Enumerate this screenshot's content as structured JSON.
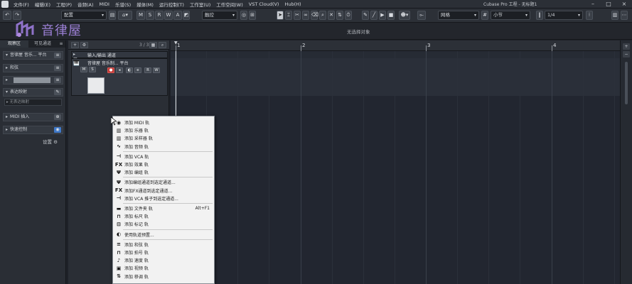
{
  "menubar": {
    "items": [
      "文件(F)",
      "编辑(E)",
      "工程(P)",
      "音频(A)",
      "MIDI",
      "乐谱(S)",
      "媒体(M)",
      "运行控制(T)",
      "工作室(U)",
      "工作空间(W)",
      "VST Cloud(V)",
      "Hub(H)"
    ],
    "window_title": "Cubase Pro 工程 - 无标题1",
    "window_controls": [
      "–",
      "□",
      "×"
    ]
  },
  "toolbar": {
    "undo": "↶",
    "redo": "↷",
    "preset": "配置",
    "mode_buttons": [
      "M",
      "S",
      "R",
      "W",
      "A"
    ],
    "touch_mode": "触控",
    "grid_type": "网格",
    "snap_unit": "小节",
    "quantize": "1/4"
  },
  "logo": {
    "text": "音律屋"
  },
  "info_line": {
    "no_selection": "无选择对象"
  },
  "inspector": {
    "tabs": [
      "观察区",
      "可见通道"
    ],
    "sections": [
      {
        "label": "音律屋 音乐... 平台",
        "icon": "list-icon"
      },
      {
        "label": "和弦",
        "icon": "list-icon"
      },
      {
        "label": "",
        "icon": "list-icon"
      },
      {
        "label": "表达映射",
        "icon": "edit-icon"
      },
      {
        "label": "MIDI 插入",
        "icon": "plug-icon"
      },
      {
        "label": "快速控制",
        "icon": "blue-toggle-icon"
      }
    ],
    "expression_placeholder": "无表达映射",
    "settings_label": "设置"
  },
  "track_list": {
    "count": "3 / 3",
    "tracks": [
      {
        "name": "输入/输出 通道"
      },
      {
        "name": "音律屋 音乐制... 平台",
        "buttons": [
          "M",
          "S",
          "R",
          "W"
        ]
      }
    ]
  },
  "ruler": {
    "bars": [
      "1",
      "2",
      "3",
      "4"
    ]
  },
  "context_menu": {
    "groups": [
      [
        {
          "icon": "midi-icon",
          "label": "添加 MIDI 轨"
        },
        {
          "icon": "piano-icon",
          "label": "添加 乐器 轨"
        },
        {
          "icon": "sampler-icon",
          "label": "添加 采样器 轨"
        },
        {
          "icon": "audio-wave-icon",
          "label": "添加 音频 轨"
        }
      ],
      [
        {
          "icon": "vca-icon",
          "label": "添加 VCA 轨"
        },
        {
          "icon": "fx-icon",
          "label": "添加 效果 轨"
        },
        {
          "icon": "group-icon",
          "label": "添加 编组 轨"
        }
      ],
      [
        {
          "icon": "group-icon",
          "label": "添加编组通道到选定通道..."
        },
        {
          "icon": "fx-icon",
          "label": "添加FX通道到选定通道..."
        },
        {
          "icon": "vca-icon",
          "label": "添加 VCA 推子到选定通道..."
        }
      ],
      [
        {
          "icon": "folder-icon",
          "label": "添加 文件夹 轨",
          "shortcut": "Alt+F1"
        },
        {
          "icon": "ruler-icon",
          "label": "添加 标尺 轨"
        },
        {
          "icon": "marker-icon",
          "label": "添加 标记 轨"
        }
      ],
      [
        {
          "icon": "preset-icon",
          "label": "使用轨道预置..."
        }
      ],
      [
        {
          "icon": "chord-icon",
          "label": "添加 和弦 轨"
        },
        {
          "icon": "signature-icon",
          "label": "添加 拍号 轨"
        },
        {
          "icon": "tempo-icon",
          "label": "添加 速度 轨"
        },
        {
          "icon": "video-icon",
          "label": "添加 视频 轨"
        },
        {
          "icon": "transpose-icon",
          "label": "添加 移调 轨"
        }
      ]
    ]
  }
}
